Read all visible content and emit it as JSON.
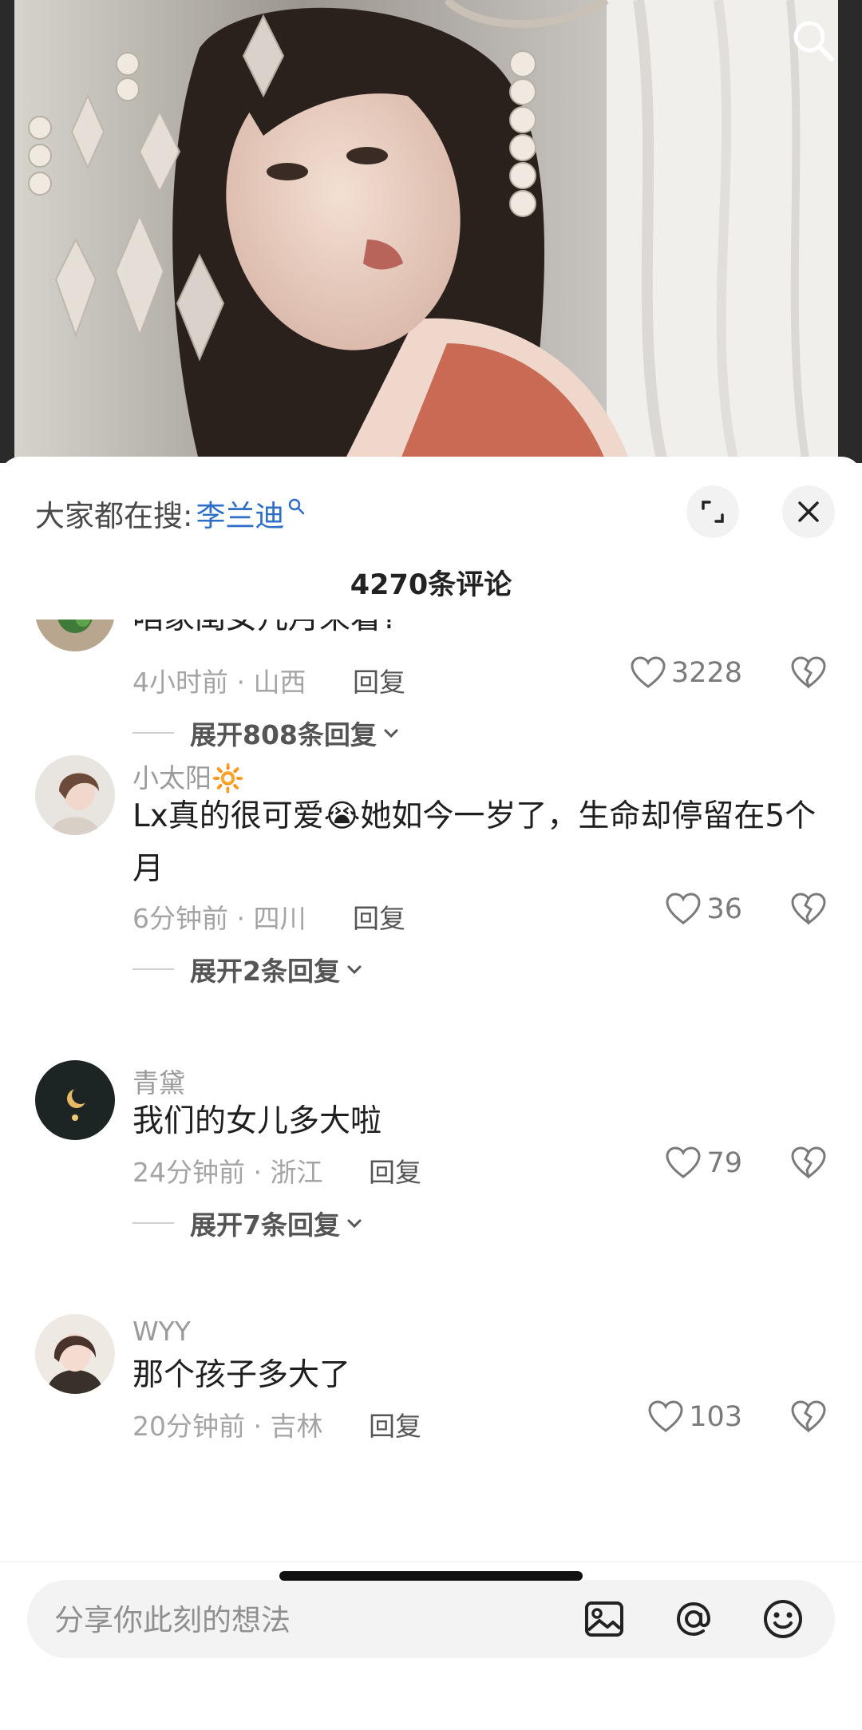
{
  "hot_search": {
    "label": "大家都在搜:",
    "term": "李兰迪"
  },
  "comment_count": "4270条评论",
  "comments": [
    {
      "username": "",
      "text": "咱家闺女几月来着?",
      "time_location": "4小时前 · 山西",
      "reply_label": "回复",
      "likes": "3228",
      "expand_label": "展开808条回复"
    },
    {
      "username": "小太阳🔆",
      "text": "Lx真的很可爱😭她如今一岁了，生命却停留在5个月",
      "time_location": "6分钟前 · 四川",
      "reply_label": "回复",
      "likes": "36",
      "expand_label": "展开2条回复"
    },
    {
      "username": "青黛",
      "text": "我们的女儿多大啦",
      "time_location": "24分钟前 · 浙江",
      "reply_label": "回复",
      "likes": "79",
      "expand_label": "展开7条回复"
    },
    {
      "username": "WYY",
      "text": "那个孩子多大了",
      "time_location": "20分钟前 · 吉林",
      "reply_label": "回复",
      "likes": "103"
    }
  ],
  "input": {
    "placeholder": "分享你此刻的想法"
  },
  "icons": {
    "search": "search-icon",
    "expand": "fullscreen-icon",
    "close": "close-icon",
    "like": "heart-icon",
    "dislike": "broken-heart-icon",
    "image": "image-icon",
    "mention": "at-icon",
    "emoji": "emoji-icon"
  }
}
